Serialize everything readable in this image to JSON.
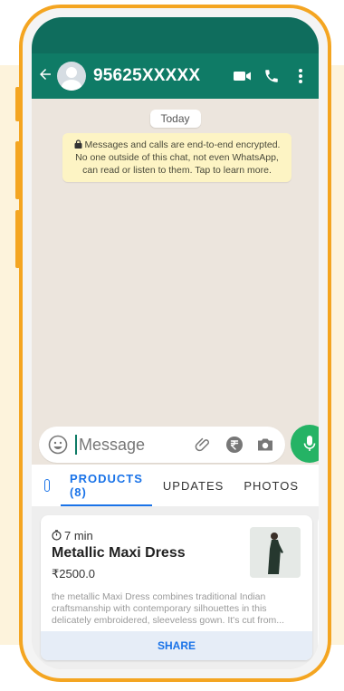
{
  "header": {
    "contact_name": "95625XXXXX",
    "back_icon": "back-arrow-icon",
    "icons": [
      "video-call-icon",
      "voice-call-icon",
      "more-vert-icon"
    ]
  },
  "chat": {
    "date_chip": "Today",
    "encryption_notice": "Messages and calls are end-to-end encrypted. No one outside of this chat, not even WhatsApp, can read or listen to them. Tap to learn more."
  },
  "composer": {
    "placeholder": "Message",
    "icons": [
      "emoji-icon",
      "attach-icon",
      "rupee-payment-icon",
      "camera-icon",
      "mic-icon"
    ]
  },
  "tabs": [
    {
      "label": "PRODUCTS (8)",
      "active": true
    },
    {
      "label": "UPDATES",
      "active": false
    },
    {
      "label": "PHOTOS",
      "active": false
    }
  ],
  "product_card": {
    "time": "7 min",
    "title": "Metallic Maxi Dress",
    "price": "₹2500.0",
    "description": "the metallic Maxi Dress combines traditional Indian craftsmanship with contemporary silhouettes in this delicately embroidered, sleeveless gown. It's cut from...",
    "share_label": "SHARE"
  },
  "colors": {
    "accent_frame": "#f4a521",
    "header_green": "#0f7b66",
    "status_green": "#0f6d5d",
    "mic_green": "#25b365",
    "tab_blue": "#1a73e8",
    "notice_yellow": "#fdf4c4"
  }
}
